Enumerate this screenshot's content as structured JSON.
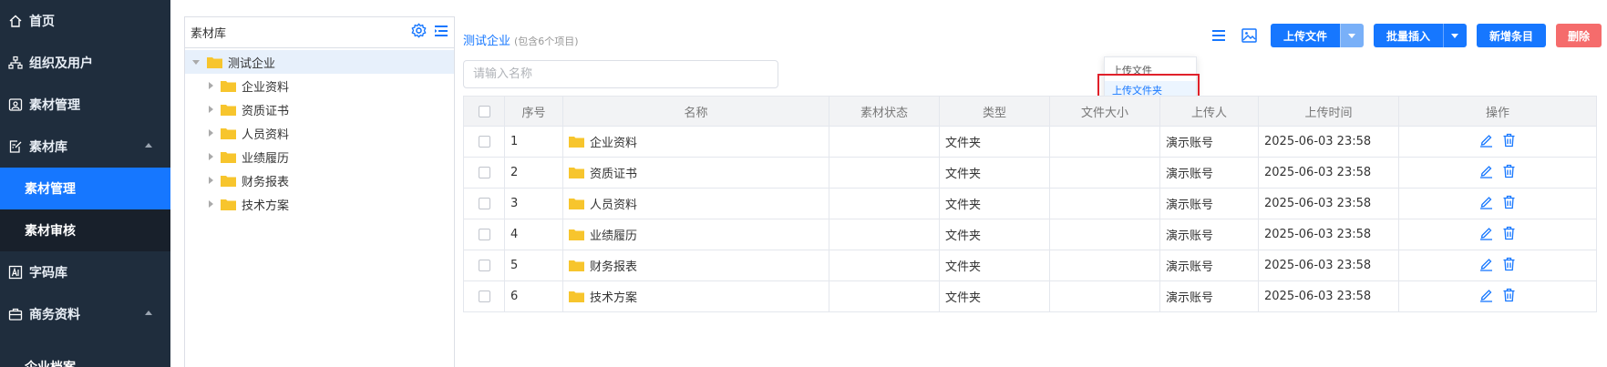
{
  "sidebar": {
    "items": [
      {
        "label": "首页",
        "icon": "home-icon"
      },
      {
        "label": "组织及用户",
        "icon": "org-icon"
      },
      {
        "label": "素材管理",
        "icon": "material-icon"
      },
      {
        "label": "素材库",
        "icon": "edit-doc-icon"
      },
      {
        "label": "字码库",
        "icon": "font-icon"
      },
      {
        "label": "商务资料",
        "icon": "briefcase-icon"
      }
    ],
    "sub_items": [
      {
        "label": "素材管理",
        "active": true
      },
      {
        "label": "素材审核",
        "active": false
      }
    ],
    "cut_label": "企业档案"
  },
  "tree": {
    "title": "素材库",
    "root": "测试企业",
    "children": [
      "企业资料",
      "资质证书",
      "人员资料",
      "业绩履历",
      "财务报表",
      "技术方案"
    ]
  },
  "header": {
    "crumb_name": "测试企业",
    "crumb_count": "(包含6个项目)",
    "search_placeholder": "请输入名称"
  },
  "toolbar": {
    "upload_label": "上传文件",
    "batch_label": "批量插入",
    "new_label": "新增条目",
    "delete_label": "删除"
  },
  "dropdown": {
    "items": [
      "上传文件",
      "上传文件夹"
    ]
  },
  "table": {
    "headers": [
      "序号",
      "名称",
      "素材状态",
      "类型",
      "文件大小",
      "上传人",
      "上传时间",
      "操作"
    ],
    "rows": [
      {
        "no": "1",
        "name": "企业资料",
        "type": "文件夹",
        "uploader": "演示账号",
        "time": "2025-06-03 23:58"
      },
      {
        "no": "2",
        "name": "资质证书",
        "type": "文件夹",
        "uploader": "演示账号",
        "time": "2025-06-03 23:58"
      },
      {
        "no": "3",
        "name": "人员资料",
        "type": "文件夹",
        "uploader": "演示账号",
        "time": "2025-06-03 23:58"
      },
      {
        "no": "4",
        "name": "业绩履历",
        "type": "文件夹",
        "uploader": "演示账号",
        "time": "2025-06-03 23:58"
      },
      {
        "no": "5",
        "name": "财务报表",
        "type": "文件夹",
        "uploader": "演示账号",
        "time": "2025-06-03 23:58"
      },
      {
        "no": "6",
        "name": "技术方案",
        "type": "文件夹",
        "uploader": "演示账号",
        "time": "2025-06-03 23:58"
      }
    ]
  },
  "colors": {
    "accent": "#1677ff",
    "danger": "#f56c6c",
    "folder": "#f7c52d",
    "sidebar": "#1f2d3d"
  }
}
